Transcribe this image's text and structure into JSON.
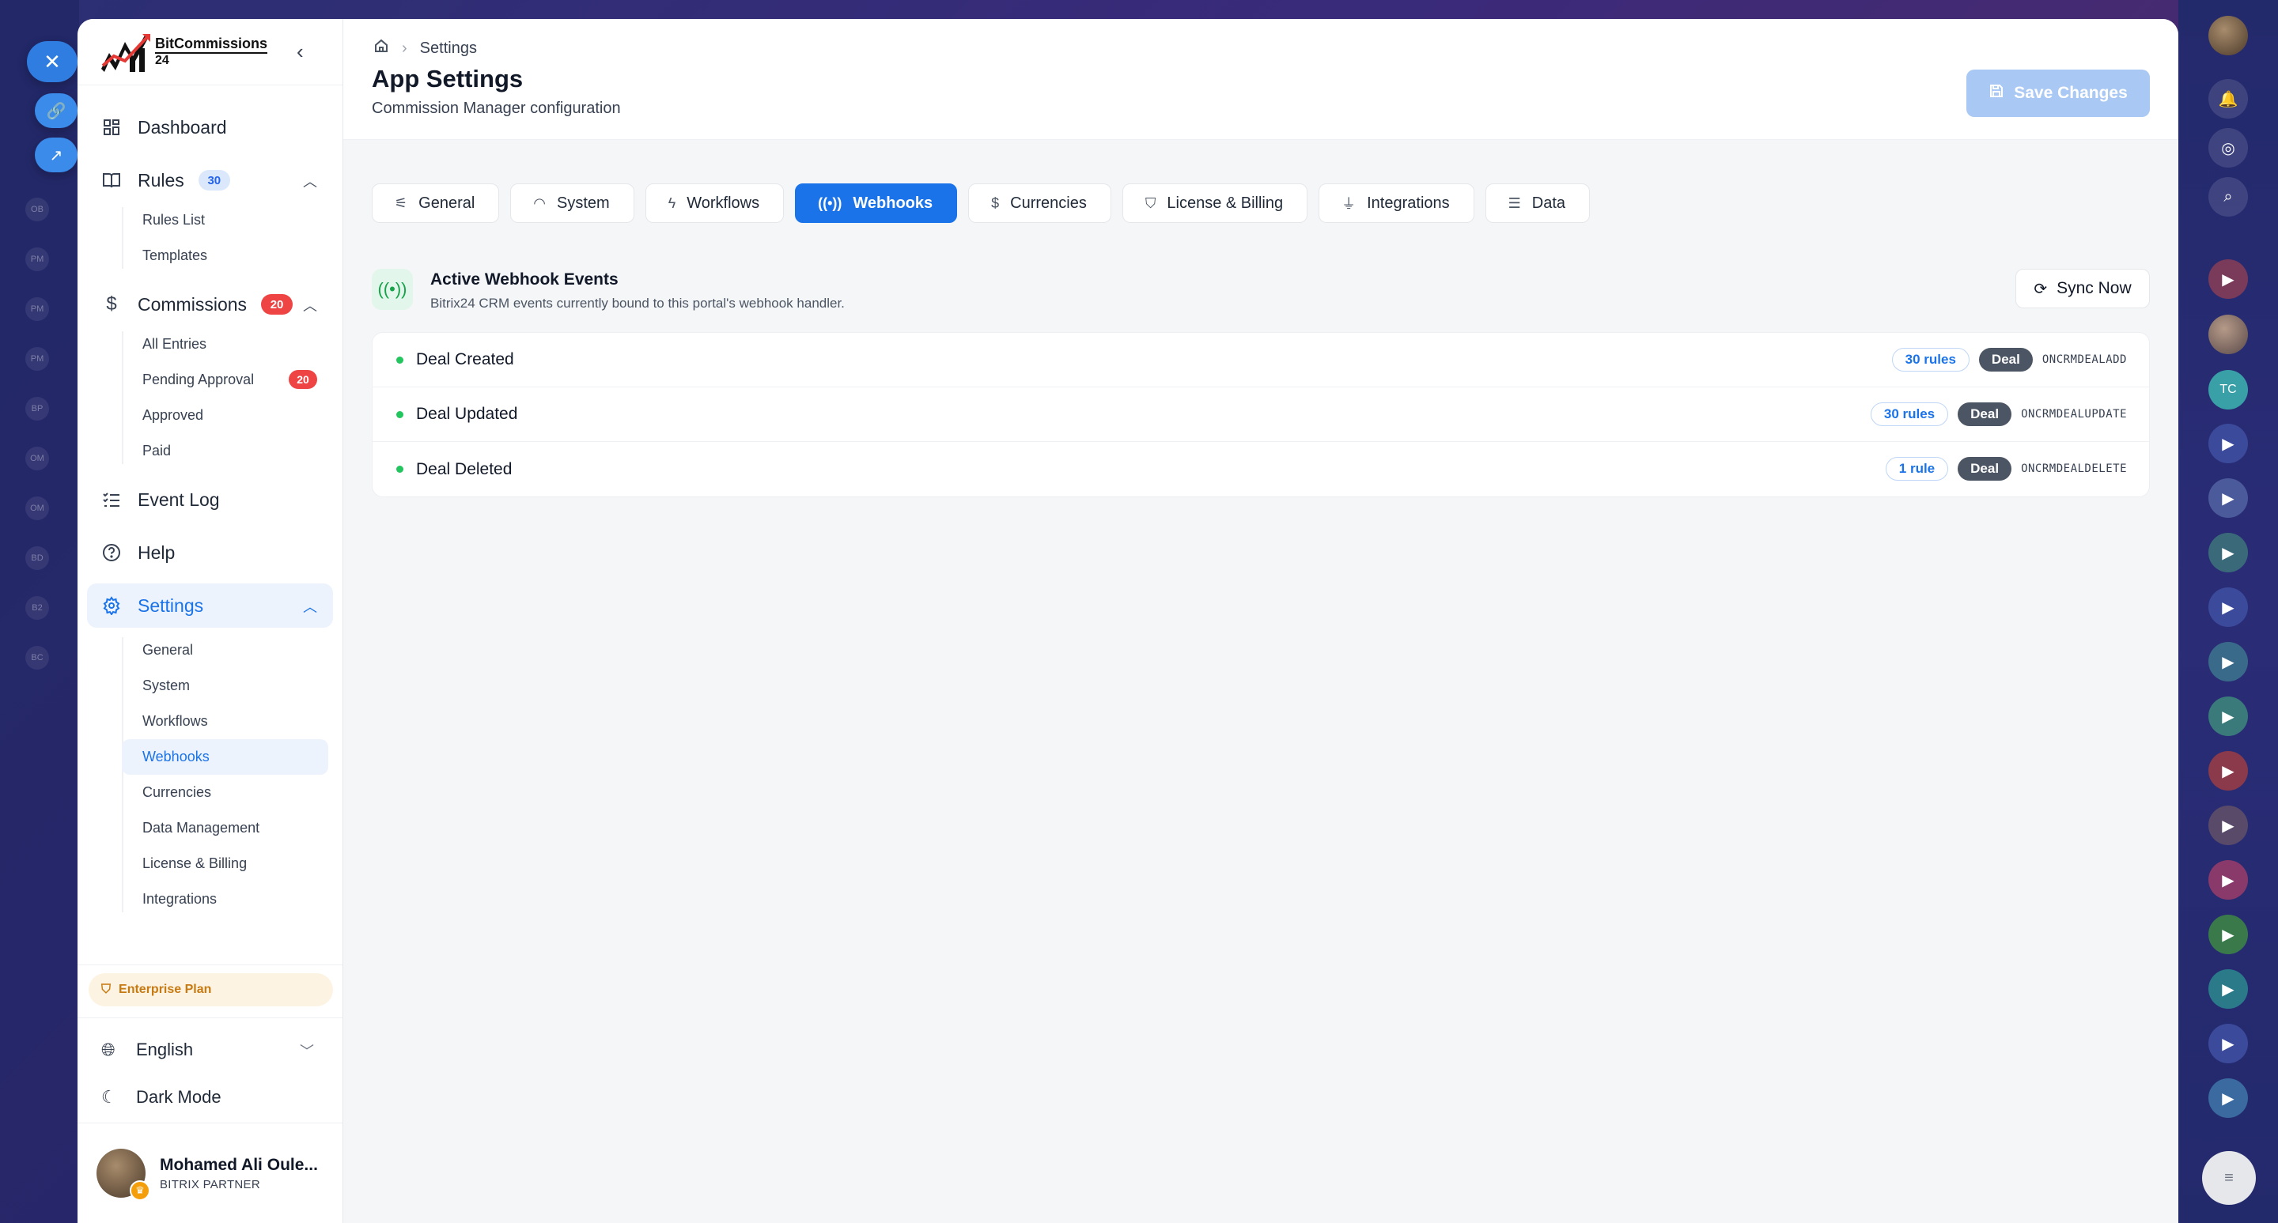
{
  "app": {
    "brand_name": "BitCommissions",
    "brand_sub": "24",
    "collapse_icon": "chevron-left-icon"
  },
  "background": {
    "left_ghosts": [
      "OB",
      "PM",
      "PM",
      "PM",
      "BP",
      "OM",
      "OM",
      "BD",
      "B2",
      "BC"
    ]
  },
  "sidebar": {
    "nav": [
      {
        "id": "dashboard",
        "label": "Dashboard",
        "icon": "grid-icon"
      },
      {
        "id": "rules",
        "label": "Rules",
        "icon": "book-icon",
        "badge": "30"
      },
      {
        "id": "commissions",
        "label": "Commissions",
        "icon": "dollar-icon",
        "badge": "20"
      },
      {
        "id": "event-log",
        "label": "Event Log",
        "icon": "list-check-icon"
      },
      {
        "id": "help",
        "label": "Help",
        "icon": "help-circle-icon"
      },
      {
        "id": "settings",
        "label": "Settings",
        "icon": "gear-icon"
      }
    ],
    "rules_sub": [
      "Rules List",
      "Templates"
    ],
    "commissions_sub": [
      {
        "label": "All Entries"
      },
      {
        "label": "Pending Approval",
        "badge": "20"
      },
      {
        "label": "Approved"
      },
      {
        "label": "Paid"
      }
    ],
    "settings_sub": [
      "General",
      "System",
      "Workflows",
      "Webhooks",
      "Currencies",
      "Data Management",
      "License & Billing",
      "Integrations"
    ],
    "plan": "Enterprise Plan",
    "language": "English",
    "dark_mode": "Dark Mode",
    "user": {
      "name": "Mohamed Ali Oule...",
      "role": "BITRIX PARTNER"
    }
  },
  "header": {
    "breadcrumb": "Settings",
    "title": "App Settings",
    "subtitle": "Commission Manager configuration",
    "save_label": "Save Changes"
  },
  "tabs": [
    {
      "label": "General",
      "icon": "sliders-icon"
    },
    {
      "label": "System",
      "icon": "gauge-icon"
    },
    {
      "label": "Workflows",
      "icon": "bolt-icon"
    },
    {
      "label": "Webhooks",
      "icon": "broadcast-icon",
      "active": true
    },
    {
      "label": "Currencies",
      "icon": "dollar-icon"
    },
    {
      "label": "License & Billing",
      "icon": "shield-icon"
    },
    {
      "label": "Integrations",
      "icon": "plug-icon"
    },
    {
      "label": "Data",
      "icon": "database-icon"
    }
  ],
  "webhooks": {
    "title": "Active Webhook Events",
    "subtitle": "Bitrix24 CRM events currently bound to this portal's webhook handler.",
    "sync_label": "Sync Now",
    "events": [
      {
        "name": "Deal Created",
        "rules": "30 rules",
        "entity": "Deal",
        "code": "ONCRMDEALADD"
      },
      {
        "name": "Deal Updated",
        "rules": "30 rules",
        "entity": "Deal",
        "code": "ONCRMDEALUPDATE"
      },
      {
        "name": "Deal Deleted",
        "rules": "1 rule",
        "entity": "Deal",
        "code": "ONCRMDEALDELETE"
      }
    ]
  },
  "right_bar": {
    "initials": "TC"
  },
  "colors": {
    "accent": "#1a73e8",
    "active_bg": "#edf3fd",
    "danger": "#ef4444",
    "success": "#22c55e",
    "plan": "#c77a12"
  }
}
